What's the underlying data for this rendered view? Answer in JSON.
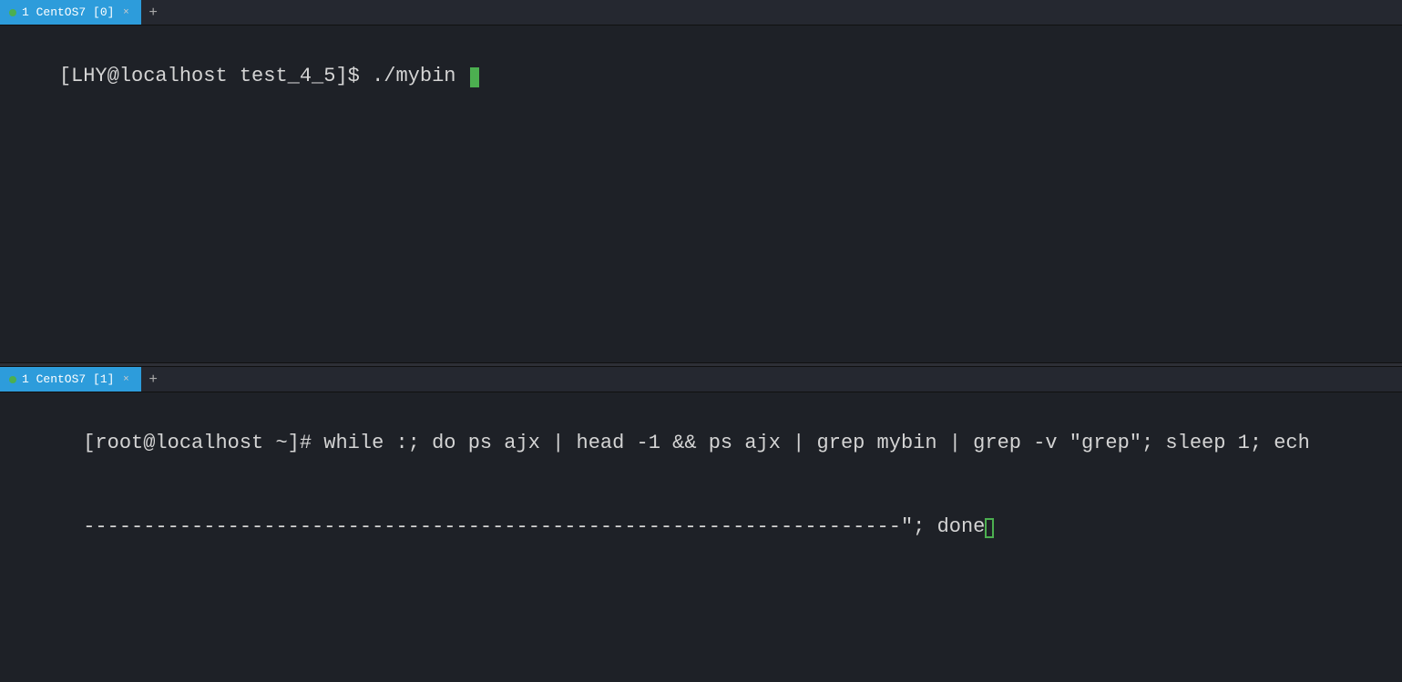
{
  "top_pane": {
    "tab": {
      "dot_color": "#4caf50",
      "label": "1 CentOS7 [0]",
      "close": "×"
    },
    "tab_add": "+",
    "command_line": "[LHY@localhost test_4_5]$ ./mybin "
  },
  "bottom_pane": {
    "tab": {
      "dot_color": "#4caf50",
      "label": "1 CentOS7 [1]",
      "close": "×"
    },
    "tab_add": "+",
    "line1": "[root@localhost ~]# while :; do ps ajx | head -1 && ps ajx | grep mybin | grep -v \"grep\"; sleep 1; ech",
    "line2": "--------------------------------------------------------------------\"; done"
  }
}
